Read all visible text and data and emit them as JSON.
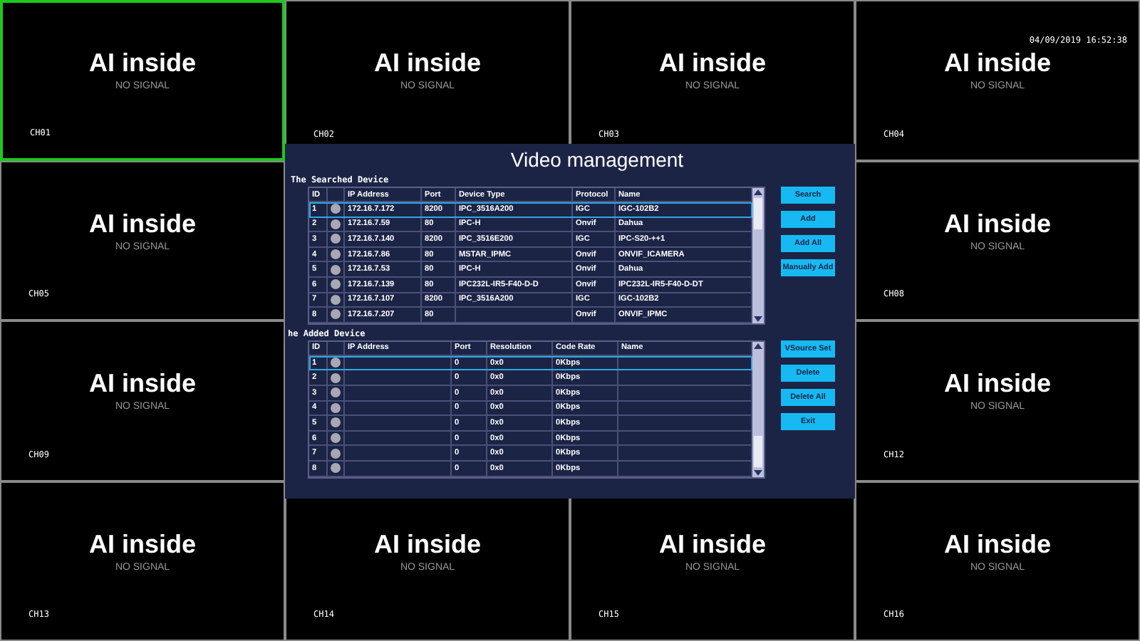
{
  "channels": [
    {
      "label": "CH01",
      "title": "AI inside",
      "status": "NO SIGNAL",
      "selected": true
    },
    {
      "label": "CH02",
      "title": "AI inside",
      "status": "NO SIGNAL",
      "selected": false
    },
    {
      "label": "CH03",
      "title": "AI inside",
      "status": "NO SIGNAL",
      "selected": false
    },
    {
      "label": "CH04",
      "title": "AI inside",
      "status": "NO SIGNAL",
      "selected": false,
      "timestamp": "04/09/2019 16:52:38"
    },
    {
      "label": "CH05",
      "title": "AI inside",
      "status": "NO SIGNAL",
      "selected": false
    },
    {
      "label": "CH08",
      "title": "AI inside",
      "status": "NO SIGNAL",
      "selected": false
    },
    {
      "label": "CH09",
      "title": "AI inside",
      "status": "NO SIGNAL",
      "selected": false
    },
    {
      "label": "CH12",
      "title": "AI inside",
      "status": "NO SIGNAL",
      "selected": false
    },
    {
      "label": "CH13",
      "title": "AI inside",
      "status": "NO SIGNAL",
      "selected": false
    },
    {
      "label": "CH14",
      "title": "AI inside",
      "status": "NO SIGNAL",
      "selected": false
    },
    {
      "label": "CH15",
      "title": "AI inside",
      "status": "NO SIGNAL",
      "selected": false
    },
    {
      "label": "CH16",
      "title": "AI inside",
      "status": "NO SIGNAL",
      "selected": false
    }
  ],
  "dialog": {
    "title": "Video management",
    "searched": {
      "label": "The Searched Device",
      "columns": [
        "ID",
        "IP Address",
        "Port",
        "Device Type",
        "Protocol",
        "Name"
      ],
      "rows": [
        {
          "selected": true,
          "cells": {
            "id": "1",
            "ip": "172.16.7.172",
            "port": "8200",
            "type": "IPC_3516A200",
            "protocol": "IGC",
            "name": "IGC-102B2"
          }
        },
        {
          "selected": false,
          "cells": {
            "id": "2",
            "ip": "172.16.7.59",
            "port": "80",
            "type": "IPC-H",
            "protocol": "Onvif",
            "name": "Dahua"
          }
        },
        {
          "selected": false,
          "cells": {
            "id": "3",
            "ip": "172.16.7.140",
            "port": "8200",
            "type": "IPC_3516E200",
            "protocol": "IGC",
            "name": "IPC-S20-++1"
          }
        },
        {
          "selected": false,
          "cells": {
            "id": "4",
            "ip": "172.16.7.86",
            "port": "80",
            "type": "MSTAR_IPMC",
            "protocol": "Onvif",
            "name": "ONVIF_ICAMERA"
          }
        },
        {
          "selected": false,
          "cells": {
            "id": "5",
            "ip": "172.16.7.53",
            "port": "80",
            "type": "IPC-H",
            "protocol": "Onvif",
            "name": "Dahua"
          }
        },
        {
          "selected": false,
          "cells": {
            "id": "6",
            "ip": "172.16.7.139",
            "port": "80",
            "type": "IPC232L-IR5-F40-D-D",
            "protocol": "Onvif",
            "name": "IPC232L-IR5-F40-D-DT"
          }
        },
        {
          "selected": false,
          "cells": {
            "id": "7",
            "ip": "172.16.7.107",
            "port": "8200",
            "type": "IPC_3516A200",
            "protocol": "IGC",
            "name": "IGC-102B2"
          }
        },
        {
          "selected": false,
          "cells": {
            "id": "8",
            "ip": "172.16.7.207",
            "port": "80",
            "protocol": "Onvif",
            "name": "ONVIF_IPMC"
          }
        }
      ],
      "buttons": [
        "Search",
        "Add",
        "Add All",
        "Manually Add"
      ]
    },
    "added": {
      "label": "he Added Device",
      "columns": [
        "ID",
        "IP Address",
        "Port",
        "Resolution",
        "Code Rate",
        "Name"
      ],
      "rows": [
        {
          "selected": true,
          "cells": {
            "id": "1",
            "port": "0",
            "resolution": "0x0",
            "rate": "0Kbps"
          }
        },
        {
          "selected": false,
          "cells": {
            "id": "2",
            "port": "0",
            "resolution": "0x0",
            "rate": "0Kbps"
          }
        },
        {
          "selected": false,
          "cells": {
            "id": "3",
            "port": "0",
            "resolution": "0x0",
            "rate": "0Kbps"
          }
        },
        {
          "selected": false,
          "cells": {
            "id": "4",
            "port": "0",
            "resolution": "0x0",
            "rate": "0Kbps"
          }
        },
        {
          "selected": false,
          "cells": {
            "id": "5",
            "port": "0",
            "resolution": "0x0",
            "rate": "0Kbps"
          }
        },
        {
          "selected": false,
          "cells": {
            "id": "6",
            "port": "0",
            "resolution": "0x0",
            "rate": "0Kbps"
          }
        },
        {
          "selected": false,
          "cells": {
            "id": "7",
            "port": "0",
            "resolution": "0x0",
            "rate": "0Kbps"
          }
        },
        {
          "selected": false,
          "cells": {
            "id": "8",
            "port": "0",
            "resolution": "0x0",
            "rate": "0Kbps"
          }
        }
      ],
      "buttons": [
        "VSource Set",
        "Delete",
        "Delete All",
        "Exit"
      ]
    }
  }
}
